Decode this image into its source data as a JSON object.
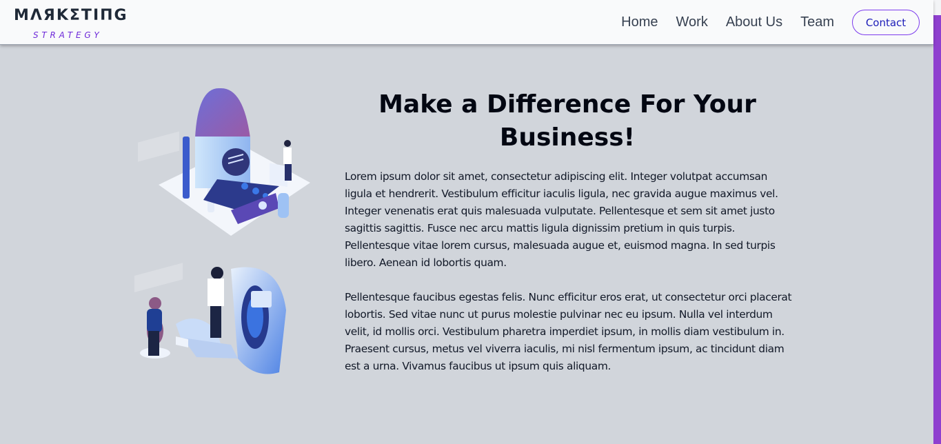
{
  "header": {
    "brand_main": "MΛЯΚΣΤΙΠG",
    "brand_sub": "STRATEGY",
    "nav": [
      "Home",
      "Work",
      "About Us",
      "Team"
    ],
    "contact_label": "Contact"
  },
  "hero": {
    "title": "Make a Difference For Your Business!",
    "paragraphs": [
      "Lorem ipsum dolor sit amet, consectetur adipiscing elit. Integer volutpat accumsan ligula et hendrerit. Vestibulum efficitur iaculis ligula, nec gravida augue maximus vel. Integer venenatis erat quis malesuada vulputate. Pellentesque et sem sit amet justo sagittis sagittis. Fusce nec arcu mattis ligula dignissim pretium in quis turpis. Pellentesque vitae lorem cursus, malesuada augue et, euismod magna. In sed turpis libero. Aenean id lobortis quam.",
      "Pellentesque faucibus egestas felis. Nunc efficitur eros erat, ut consectetur orci placerat lobortis. Sed vitae nunc ut purus molestie pulvinar nec eu ipsum. Nulla vel interdum velit, id mollis orci. Vestibulum pharetra imperdiet ipsum, in mollis diam vestibulum in. Praesent cursus, metus vel viverra iaculis, mi nisl fermentum ipsum, ac tincidunt diam est a urna. Vivamus faucibus ut ipsum quis aliquam."
    ]
  },
  "colors": {
    "page_bg": "#d1d5db",
    "header_bg": "#f9fafb",
    "accent": "#7c3aed",
    "contact_text": "#1d1db8",
    "scrollbar": "#8e3fcf"
  }
}
